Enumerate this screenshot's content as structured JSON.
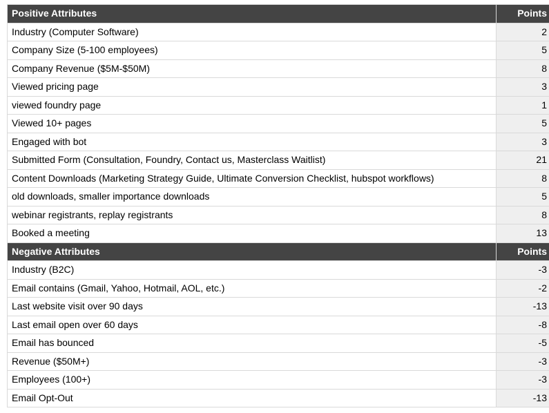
{
  "positive": {
    "header_attr": "Positive Attributes",
    "header_points": "Points",
    "rows": [
      {
        "attr": "Industry (Computer Software)",
        "points": "2"
      },
      {
        "attr": "Company Size (5-100 employees)",
        "points": "5"
      },
      {
        "attr": "Company Revenue ($5M-$50M)",
        "points": "8"
      },
      {
        "attr": "Viewed pricing page",
        "points": "3"
      },
      {
        "attr": "viewed foundry page",
        "points": "1"
      },
      {
        "attr": "Viewed 10+ pages",
        "points": "5"
      },
      {
        "attr": "Engaged with bot",
        "points": "3"
      },
      {
        "attr": "Submitted Form (Consultation, Foundry, Contact us, Masterclass Waitlist)",
        "points": "21"
      },
      {
        "attr": "Content Downloads (Marketing Strategy Guide, Ultimate Conversion Checklist, hubspot workflows)",
        "points": "8"
      },
      {
        "attr": "old downloads, smaller importance downloads",
        "points": "5"
      },
      {
        "attr": "webinar registrants, replay registrants",
        "points": "8"
      },
      {
        "attr": "Booked a meeting",
        "points": "13"
      }
    ]
  },
  "negative": {
    "header_attr": "Negative Attributes",
    "header_points": "Points",
    "rows": [
      {
        "attr": "Industry (B2C)",
        "points": "-3"
      },
      {
        "attr": "Email contains (Gmail, Yahoo, Hotmail, AOL, etc.)",
        "points": "-2"
      },
      {
        "attr": "Last website visit over 90 days",
        "points": "-13"
      },
      {
        "attr": "Last email open over 60 days",
        "points": "-8"
      },
      {
        "attr": "Email has bounced",
        "points": "-5"
      },
      {
        "attr": "Revenue ($50M+)",
        "points": "-3"
      },
      {
        "attr": "Employees (100+)",
        "points": "-3"
      },
      {
        "attr": "Email Opt-Out",
        "points": "-13"
      }
    ]
  }
}
